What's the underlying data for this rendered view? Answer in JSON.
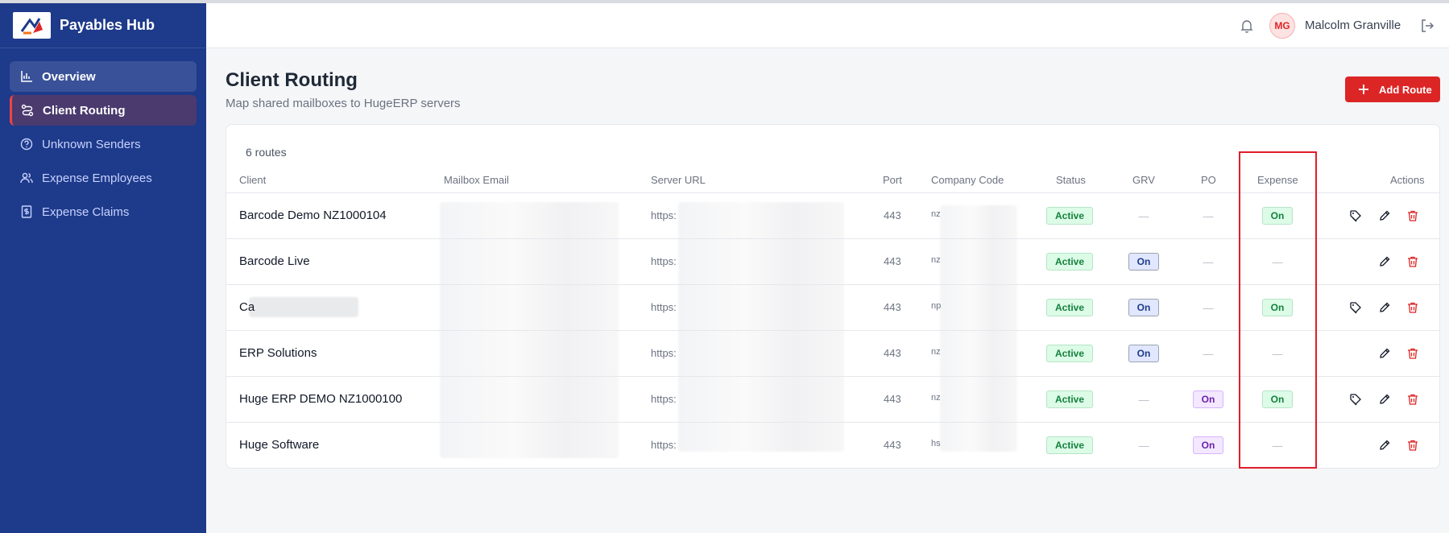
{
  "app": {
    "name": "Payables Hub"
  },
  "sidebar": {
    "items": [
      {
        "label": "Overview",
        "icon": "bar-chart-icon"
      },
      {
        "label": "Client Routing",
        "icon": "routing-icon"
      },
      {
        "label": "Unknown Senders",
        "icon": "question-circle-icon"
      },
      {
        "label": "Expense Employees",
        "icon": "users-icon"
      },
      {
        "label": "Expense Claims",
        "icon": "receipt-icon"
      }
    ]
  },
  "header": {
    "user_initials": "MG",
    "user_name": "Malcolm Granville"
  },
  "page": {
    "title": "Client Routing",
    "subtitle": "Map shared mailboxes to HugeERP servers",
    "add_button": "Add Route"
  },
  "table": {
    "count": "6 routes",
    "columns": [
      "Client",
      "Mailbox Email",
      "Server URL",
      "Port",
      "Company Code",
      "Status",
      "GRV",
      "PO",
      "Expense",
      "Actions"
    ],
    "rows": [
      {
        "client": "Barcode Demo NZ1000104",
        "server": "https:",
        "port": "443",
        "company": "nz",
        "status": "Active",
        "grv": "—",
        "po": "—",
        "expense": "On",
        "has_tag": true
      },
      {
        "client": "Barcode Live",
        "server": "https:",
        "port": "443",
        "company": "nz",
        "status": "Active",
        "grv": "On",
        "po": "—",
        "expense": "—",
        "has_tag": false
      },
      {
        "client": "Ca",
        "server": "https:",
        "port": "443",
        "company": "np",
        "status": "Active",
        "grv": "On",
        "po": "—",
        "expense": "On",
        "has_tag": true
      },
      {
        "client": "ERP Solutions",
        "server": "https:",
        "port": "443",
        "company": "nz",
        "status": "Active",
        "grv": "On",
        "po": "—",
        "expense": "—",
        "has_tag": false
      },
      {
        "client": "Huge ERP DEMO NZ1000100",
        "server": "https:",
        "port": "443",
        "company": "nz",
        "status": "Active",
        "grv": "—",
        "po": "On",
        "expense": "On",
        "has_tag": true
      },
      {
        "client": "Huge Software",
        "server": "https:",
        "port": "443",
        "company": "hs",
        "status": "Active",
        "grv": "—",
        "po": "On",
        "expense": "—",
        "has_tag": false
      }
    ]
  },
  "colors": {
    "sidebar": "#1e3a8a",
    "accent": "#dc2626",
    "active": "#15803d",
    "highlight": "#e11d2a"
  }
}
